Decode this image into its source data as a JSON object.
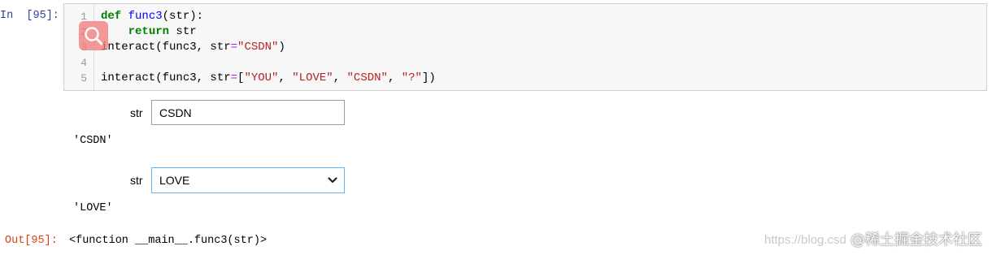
{
  "input_prompt": "In  [95]:",
  "code": {
    "line_numbers": [
      "1",
      "2",
      "3",
      "4",
      "5"
    ],
    "line1": {
      "kw": "def",
      "name": "func3",
      "rest": "(str):"
    },
    "line2": {
      "indent": "    ",
      "kw": "return",
      "rest": " str"
    },
    "line3": {
      "call": "interact(func3, str",
      "eq": "=",
      "value": "\"CSDN\"",
      "close": ")"
    },
    "line5": {
      "call": "interact(func3, str",
      "eq": "=",
      "open": "[",
      "v1": "\"YOU\"",
      "sep1": ", ",
      "v2": "\"LOVE\"",
      "sep2": ", ",
      "v3": "\"CSDN\"",
      "sep3": ", ",
      "v4": "\"?\"",
      "close": "])"
    }
  },
  "widget_text": {
    "label": "str",
    "value": "CSDN"
  },
  "output_text": "'CSDN'",
  "widget_select": {
    "label": "str",
    "selected": "LOVE"
  },
  "output_select": "'LOVE'",
  "output_prompt": "Out[95]:",
  "output_result": "<function __main__.func3(str)>",
  "watermark": {
    "url": "https://blog.csd",
    "brand": "@稀土掘金技术社区"
  },
  "colors": {
    "in_prompt": "#303f9f",
    "out_prompt": "#d84315",
    "keyword": "#008000",
    "function": "#0000ff",
    "string": "#ba2121",
    "operator": "#aa22ff",
    "select_border": "#64b5f6"
  },
  "icons": {
    "search_badge": "search-icon",
    "select_arrow": "chevron-down-icon"
  }
}
